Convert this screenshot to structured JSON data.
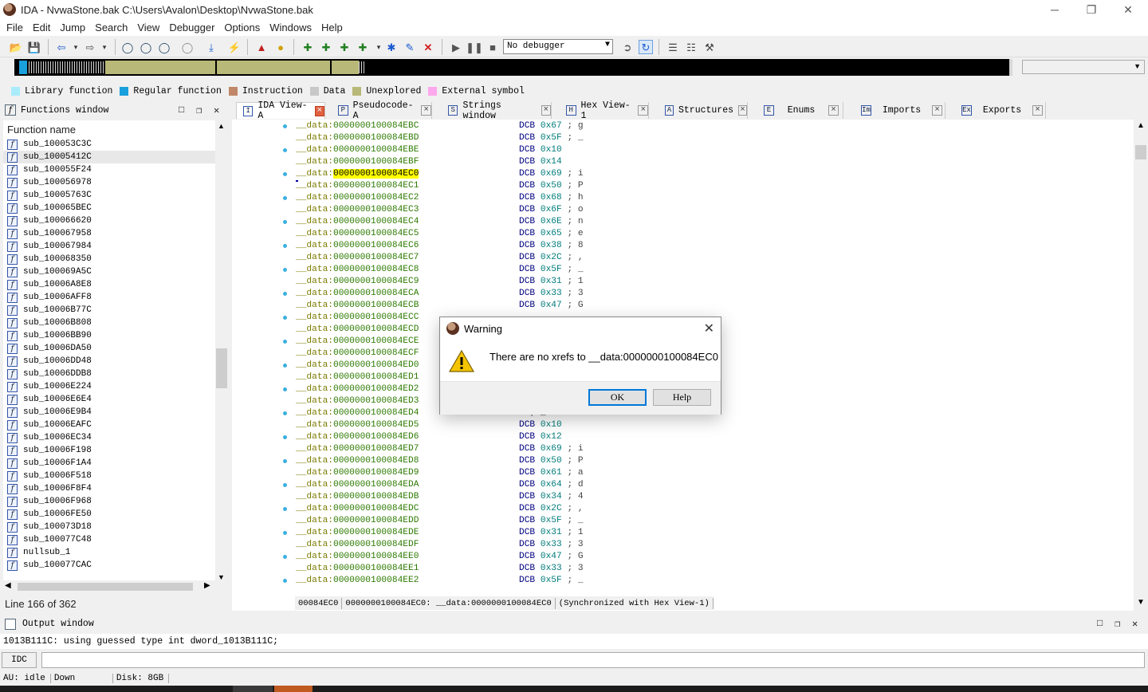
{
  "window": {
    "title": "IDA - NvwaStone.bak C:\\Users\\Avalon\\Desktop\\NvwaStone.bak",
    "min": "─",
    "max": "❐",
    "close": "✕"
  },
  "menu": [
    "File",
    "Edit",
    "Jump",
    "Search",
    "View",
    "Debugger",
    "Options",
    "Windows",
    "Help"
  ],
  "toolbar": {
    "debugger_select": "No debugger"
  },
  "legend": [
    {
      "label": "Library function",
      "color": "#a8ecfc"
    },
    {
      "label": "Regular function",
      "color": "#1aa0dc"
    },
    {
      "label": "Instruction",
      "color": "#c08868"
    },
    {
      "label": "Data",
      "color": "#c8c8c8"
    },
    {
      "label": "Unexplored",
      "color": "#b8b878"
    },
    {
      "label": "External symbol",
      "color": "#fca8ec"
    }
  ],
  "functions_window": {
    "title": "Functions window",
    "column": "Function name",
    "items": [
      "sub_100053C3C",
      "sub_10005412C",
      "sub_100055F24",
      "sub_100056978",
      "sub_10005763C",
      "sub_100065BEC",
      "sub_100066620",
      "sub_100067958",
      "sub_100067984",
      "sub_100068350",
      "sub_100069A5C",
      "sub_10006A8E8",
      "sub_10006AFF8",
      "sub_10006B77C",
      "sub_10006B808",
      "sub_10006BB90",
      "sub_10006DA50",
      "sub_10006DD48",
      "sub_10006DDB8",
      "sub_10006E224",
      "sub_10006E6E4",
      "sub_10006E9B4",
      "sub_10006EAFC",
      "sub_10006EC34",
      "sub_10006F198",
      "sub_10006F1A4",
      "sub_10006F518",
      "sub_10006F8F4",
      "sub_10006F968",
      "sub_10006FE50",
      "sub_100073D18",
      "sub_100077C48",
      "nullsub_1",
      "sub_100077CAC"
    ],
    "selected_index": 1,
    "status": "Line 166 of 362"
  },
  "tabs": [
    {
      "label": "IDA View-A",
      "icon": "I"
    },
    {
      "label": "Pseudocode-A",
      "icon": "P"
    },
    {
      "label": "Strings window",
      "icon": "S"
    },
    {
      "label": "Hex View-1",
      "icon": "H"
    },
    {
      "label": "Structures",
      "icon": "A"
    },
    {
      "label": "Enums",
      "icon": "E"
    },
    {
      "label": "Imports",
      "icon": "Im"
    },
    {
      "label": "Exports",
      "icon": "Ex"
    }
  ],
  "disasm": {
    "segment": "__data:",
    "lines": [
      {
        "addr": "0000000100084EBC",
        "mn": "DCB",
        "op": "0x67",
        "cm": "; g"
      },
      {
        "addr": "0000000100084EBD",
        "mn": "DCB",
        "op": "0x5F",
        "cm": "; _"
      },
      {
        "addr": "0000000100084EBE",
        "mn": "DCB",
        "op": "0x10",
        "cm": ""
      },
      {
        "addr": "0000000100084EBF",
        "mn": "DCB",
        "op": "0x14",
        "cm": ""
      },
      {
        "addr": "0000000100084EC0",
        "mn": "DCB",
        "op": "0x69",
        "cm": "; i",
        "hl": true
      },
      {
        "addr": "0000000100084EC1",
        "mn": "DCB",
        "op": "0x50",
        "cm": "; P"
      },
      {
        "addr": "0000000100084EC2",
        "mn": "DCB",
        "op": "0x68",
        "cm": "; h"
      },
      {
        "addr": "0000000100084EC3",
        "mn": "DCB",
        "op": "0x6F",
        "cm": "; o"
      },
      {
        "addr": "0000000100084EC4",
        "mn": "DCB",
        "op": "0x6E",
        "cm": "; n"
      },
      {
        "addr": "0000000100084EC5",
        "mn": "DCB",
        "op": "0x65",
        "cm": "; e"
      },
      {
        "addr": "0000000100084EC6",
        "mn": "DCB",
        "op": "0x38",
        "cm": "; 8"
      },
      {
        "addr": "0000000100084EC7",
        "mn": "DCB",
        "op": "0x2C",
        "cm": "; ,"
      },
      {
        "addr": "0000000100084EC8",
        "mn": "DCB",
        "op": "0x5F",
        "cm": "; _"
      },
      {
        "addr": "0000000100084EC9",
        "mn": "DCB",
        "op": "0x31",
        "cm": "; 1"
      },
      {
        "addr": "0000000100084ECA",
        "mn": "DCB",
        "op": "0x33",
        "cm": "; 3"
      },
      {
        "addr": "0000000100084ECB",
        "mn": "DCB",
        "op": "0x47",
        "cm": "; G"
      },
      {
        "addr": "0000000100084ECC",
        "mn": "",
        "op": "",
        "cm": ""
      },
      {
        "addr": "0000000100084ECD",
        "mn": "",
        "op": "",
        "cm": ""
      },
      {
        "addr": "0000000100084ECE",
        "mn": "",
        "op": "",
        "cm": ""
      },
      {
        "addr": "0000000100084ECF",
        "mn": "",
        "op": "",
        "cm": ""
      },
      {
        "addr": "0000000100084ED0",
        "mn": "",
        "op": "",
        "cm": ""
      },
      {
        "addr": "0000000100084ED1",
        "mn": "",
        "op": "",
        "cm": ""
      },
      {
        "addr": "0000000100084ED2",
        "mn": "",
        "op": "",
        "cm": ""
      },
      {
        "addr": "0000000100084ED3",
        "mn": "",
        "op": "",
        "cm": ""
      },
      {
        "addr": "0000000100084ED4",
        "mn": "",
        "op": "",
        "cm": "; _"
      },
      {
        "addr": "0000000100084ED5",
        "mn": "DCB",
        "op": "0x10",
        "cm": ""
      },
      {
        "addr": "0000000100084ED6",
        "mn": "DCB",
        "op": "0x12",
        "cm": ""
      },
      {
        "addr": "0000000100084ED7",
        "mn": "DCB",
        "op": "0x69",
        "cm": "; i"
      },
      {
        "addr": "0000000100084ED8",
        "mn": "DCB",
        "op": "0x50",
        "cm": "; P"
      },
      {
        "addr": "0000000100084ED9",
        "mn": "DCB",
        "op": "0x61",
        "cm": "; a"
      },
      {
        "addr": "0000000100084EDA",
        "mn": "DCB",
        "op": "0x64",
        "cm": "; d"
      },
      {
        "addr": "0000000100084EDB",
        "mn": "DCB",
        "op": "0x34",
        "cm": "; 4"
      },
      {
        "addr": "0000000100084EDC",
        "mn": "DCB",
        "op": "0x2C",
        "cm": "; ,"
      },
      {
        "addr": "0000000100084EDD",
        "mn": "DCB",
        "op": "0x5F",
        "cm": "; _"
      },
      {
        "addr": "0000000100084EDE",
        "mn": "DCB",
        "op": "0x31",
        "cm": "; 1"
      },
      {
        "addr": "0000000100084EDF",
        "mn": "DCB",
        "op": "0x33",
        "cm": "; 3"
      },
      {
        "addr": "0000000100084EE0",
        "mn": "DCB",
        "op": "0x47",
        "cm": "; G"
      },
      {
        "addr": "0000000100084EE1",
        "mn": "DCB",
        "op": "0x33",
        "cm": "; 3"
      },
      {
        "addr": "0000000100084EE2",
        "mn": "DCB",
        "op": "0x5F",
        "cm": "; _"
      }
    ],
    "status": [
      "00084EC0",
      "0000000100084EC0: __data:0000000100084EC0",
      "(Synchronized with Hex View-1)"
    ]
  },
  "output": {
    "title": "Output window",
    "text": "1013B111C: using guessed type int dword_1013B111C;",
    "idc_label": "IDC"
  },
  "statusbar": {
    "au": "AU:  idle",
    "dir": "Down",
    "disk": "Disk: 8GB"
  },
  "dialog": {
    "title": "Warning",
    "message": "There are no xrefs to __data:0000000100084EC0",
    "ok": "OK",
    "help": "Help"
  }
}
